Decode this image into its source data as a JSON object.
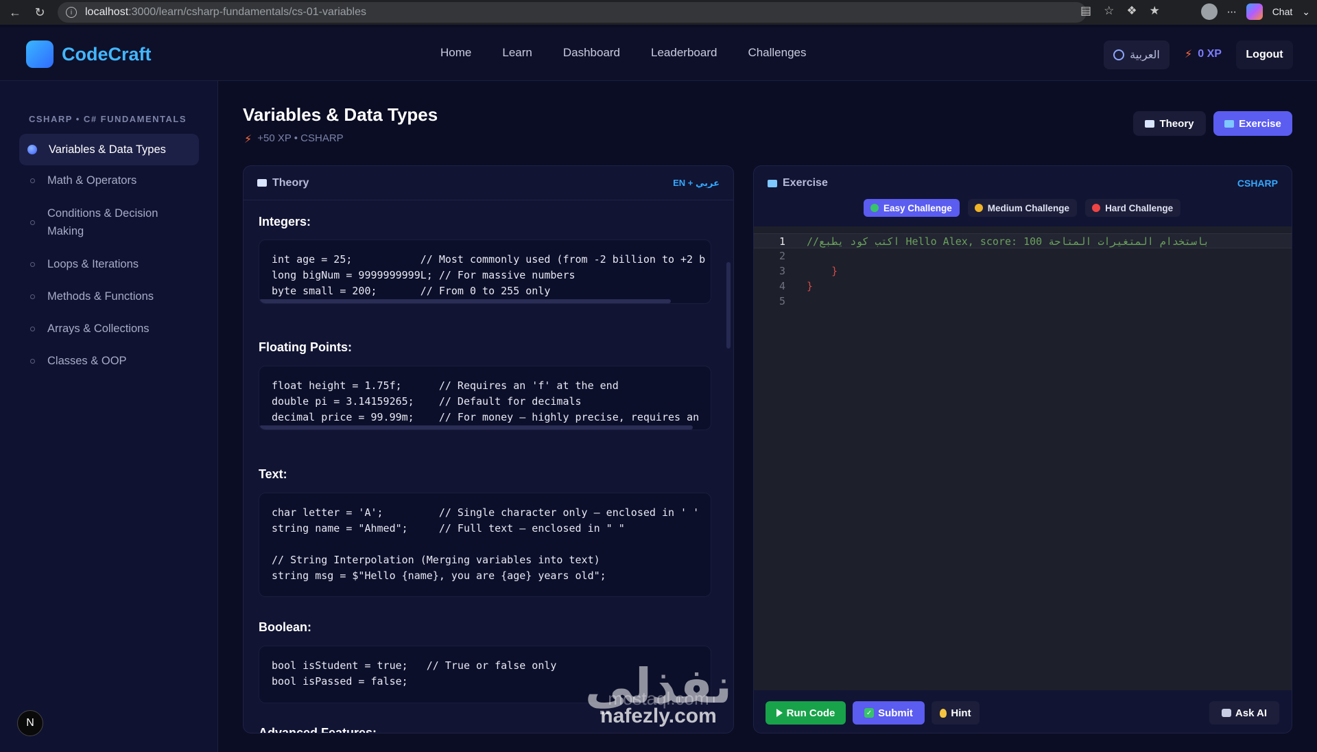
{
  "browser": {
    "url_host": "localhost",
    "url_rest": ":3000/learn/csharp-fundamentals/cs-01-variables",
    "chat_label": "Chat"
  },
  "header": {
    "brand": "CodeCraft",
    "nav": [
      "Home",
      "Learn",
      "Dashboard",
      "Leaderboard",
      "Challenges"
    ],
    "lang_button": "العربية",
    "xp": "0 XP",
    "logout": "Logout"
  },
  "sidebar": {
    "course_label": "CSHARP • C# FUNDAMENTALS",
    "items": [
      {
        "label": "Variables & Data Types",
        "active": true
      },
      {
        "label": "Math & Operators"
      },
      {
        "label": "Conditions & Decision Making"
      },
      {
        "label": "Loops & Iterations"
      },
      {
        "label": "Methods & Functions"
      },
      {
        "label": "Arrays & Collections"
      },
      {
        "label": "Classes & OOP"
      }
    ],
    "user_initial": "N"
  },
  "lesson": {
    "title": "Variables & Data Types",
    "subtitle": "+50 XP • CSHARP",
    "mode_theory": "Theory",
    "mode_exercise": "Exercise"
  },
  "theory": {
    "header": "Theory",
    "lang_tag": "EN + عربي",
    "sections": [
      {
        "title": "Integers:",
        "code": "int age = 25;           // Most commonly used (from -2 billion to +2 b\nlong bigNum = 9999999999L; // For massive numbers\nbyte small = 200;       // From 0 to 255 only"
      },
      {
        "title": "Floating Points:",
        "code": "float height = 1.75f;      // Requires an 'f' at the end\ndouble pi = 3.14159265;    // Default for decimals\ndecimal price = 99.99m;    // For money — highly precise, requires an"
      },
      {
        "title": "Text:",
        "code": "char letter = 'A';         // Single character only — enclosed in ' '\nstring name = \"Ahmed\";     // Full text — enclosed in \" \"\n\n// String Interpolation (Merging variables into text)\nstring msg = $\"Hello {name}, you are {age} years old\";"
      },
      {
        "title": "Boolean:",
        "code": "bool isStudent = true;   // True or false only\nbool isPassed = false;"
      },
      {
        "title": "Advanced Features:"
      }
    ]
  },
  "exercise": {
    "header": "Exercise",
    "lang_tag": "CSHARP",
    "difficulties": [
      {
        "label": "Easy Challenge",
        "color": "#37c46a",
        "active": true
      },
      {
        "label": "Medium Challenge",
        "color": "#f0b429"
      },
      {
        "label": "Hard Challenge",
        "color": "#ef4444"
      }
    ],
    "editor_lines": [
      {
        "num": "1",
        "text": "//اكتب كود يطبع Hello Alex, score: 100 باستخدام المتغيرات المتاحة"
      },
      {
        "num": "2",
        "text": ""
      },
      {
        "num": "3",
        "text": "    }"
      },
      {
        "num": "4",
        "text": "}"
      },
      {
        "num": "5",
        "text": ""
      }
    ],
    "buttons": {
      "run": "Run Code",
      "submit": "Submit",
      "hint": "Hint",
      "ask_ai": "Ask AI"
    }
  },
  "watermark": {
    "arabic": "نفذلي",
    "latin_back": "mostaql.com",
    "latin": "nafezly.com"
  },
  "colors": {
    "accent": "#5b5cf0",
    "brand": "#43b6ff",
    "bg": "#0b0d24",
    "run": "#18a34a"
  }
}
